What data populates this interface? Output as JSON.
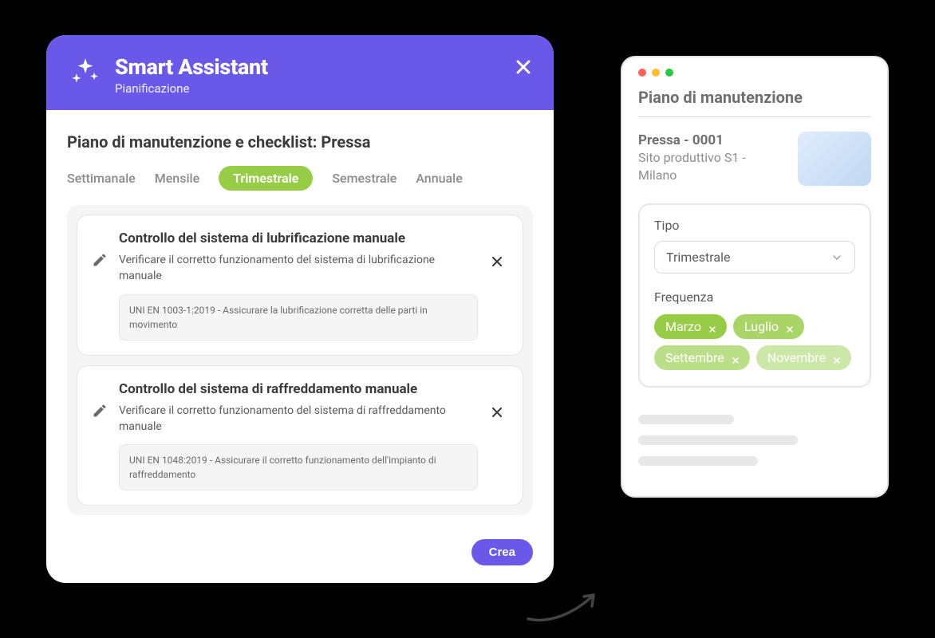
{
  "modal": {
    "title": "Smart Assistant",
    "subtitle": "Pianificazione",
    "body_title": "Piano di manutenzione e checklist: Pressa",
    "tabs": [
      {
        "label": "Settimanale",
        "active": false
      },
      {
        "label": "Mensile",
        "active": false
      },
      {
        "label": "Trimestrale",
        "active": true
      },
      {
        "label": "Semestrale",
        "active": false
      },
      {
        "label": "Annuale",
        "active": false
      }
    ],
    "items": [
      {
        "title": "Controllo del sistema di lubrificazione manuale",
        "desc": "Verificare il corretto funzionamento del sistema di lubrificazione manuale",
        "norm": "UNI EN 1003-1:2019 - Assicurare la lubrificazione corretta delle parti in movimento"
      },
      {
        "title": "Controllo del sistema di raffreddamento manuale",
        "desc": "Verificare il corretto funzionamento del sistema di raffreddamento manuale",
        "norm": "UNI EN 1048:2019 - Assicurare il corretto funzionamento dell'impianto di raffreddamento"
      }
    ],
    "create_label": "Crea"
  },
  "side": {
    "title": "Piano di manutenzione",
    "asset_name": "Pressa - 0001",
    "asset_loc": "Sito produttivo S1 - Milano",
    "config": {
      "type_label": "Tipo",
      "type_value": "Trimestrale",
      "freq_label": "Frequenza",
      "chips": [
        {
          "label": "Marzo",
          "shade": 1
        },
        {
          "label": "Luglio",
          "shade": 2
        },
        {
          "label": "Settembre",
          "shade": 3
        },
        {
          "label": "Novembre",
          "shade": 4
        }
      ]
    }
  }
}
